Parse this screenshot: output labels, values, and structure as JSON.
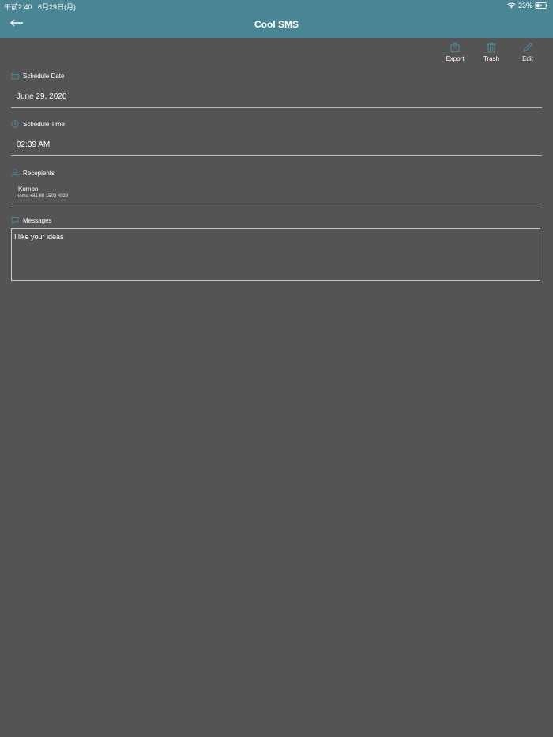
{
  "status_bar": {
    "time": "午前2:40",
    "date": "6月29日(月)",
    "battery": "23%"
  },
  "nav": {
    "title": "Cool SMS",
    "back_icon": "back-arrow-icon"
  },
  "toolbar": {
    "export_label": "Export",
    "trash_label": "Trash",
    "edit_label": "Edit"
  },
  "schedule_date": {
    "label": "Schedule Date",
    "value": "June 29, 2020"
  },
  "schedule_time": {
    "label": "Schedule Time",
    "value": "02:39 AM"
  },
  "recipients": {
    "label": "Recepients",
    "name": "Kumon",
    "phone": "home:+81 80 1502 4029"
  },
  "messages": {
    "label": "Messages",
    "value": "I like your ideas"
  },
  "colors": {
    "header": "#4a8593",
    "background": "#545454",
    "accent_icon": "#4a8593"
  }
}
